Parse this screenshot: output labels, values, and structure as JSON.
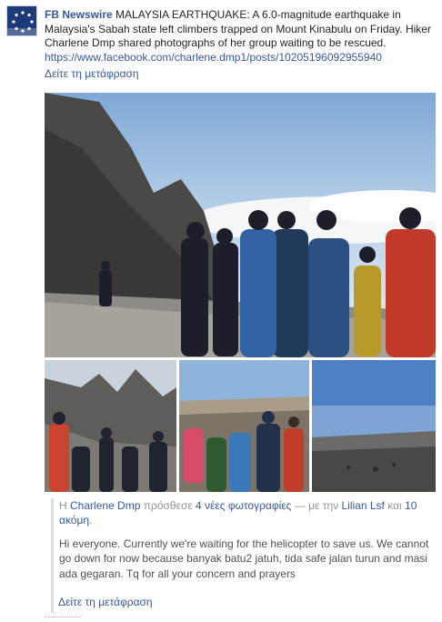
{
  "post": {
    "page_name": "FB Newswire",
    "text": "MALAYSIA EARTHQUAKE: A 6.0-magnitude earthquake in Malaysia's Sabah state left climbers trapped on Mount Kinabulu on Friday. Hiker Charlene Dmp shared photographs of her group waiting to be rescued.",
    "link": "https://www.facebook.com/charlene.dmp1/posts/10205196092955940",
    "see_translation": "Δείτε τη μετάφραση"
  },
  "shared": {
    "prefix": "Η",
    "author": "Charlene Dmp",
    "verb": "πρόσθεσε",
    "photos_label": "4 νέες φωτογραφίες",
    "with_text": "— με την",
    "tagged": "Lilian Lsf",
    "and_text": "και",
    "others": "10 ακόμη",
    "period": ".",
    "quote": "Hi everyone. Currently we're waiting for the helicopter to save us. We cannot go down for now because banyak batu2 jatuh, tida safe jalan turun and masi ada gegaran. Tq for all your concern and prayers",
    "see_translation": "Δείτε τη μετάφραση"
  },
  "colors": {
    "link": "#365899",
    "text": "#1d2129",
    "muted": "#90949c",
    "avatar_bg": "#1f3a78"
  },
  "icons": {
    "avatar": "fb-newswire-logo-icon"
  }
}
